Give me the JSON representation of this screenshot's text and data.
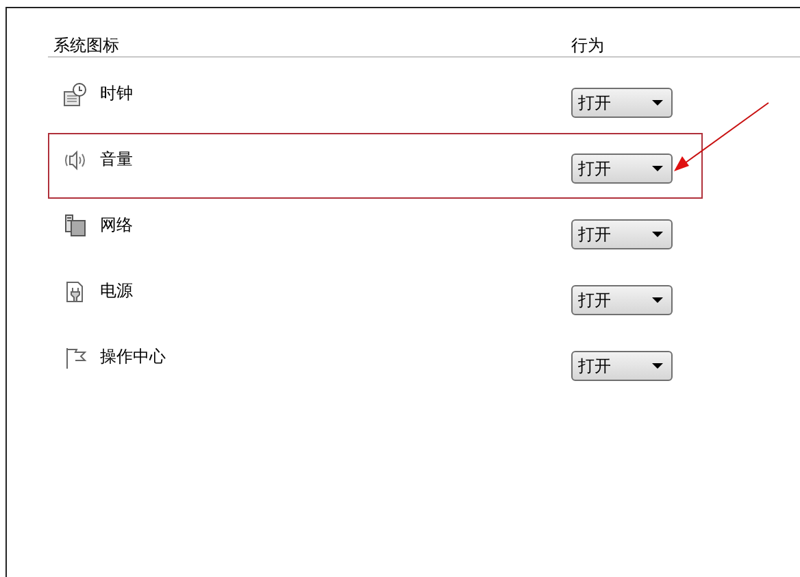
{
  "columns": [
    "系统图标",
    "行为"
  ],
  "rows": [
    {
      "kind": "clock",
      "name": "时钟",
      "behavior": "打开",
      "annotated": false
    },
    {
      "kind": "speaker",
      "name": "音量",
      "behavior": "打开",
      "annotated": true
    },
    {
      "kind": "network",
      "name": "网络",
      "behavior": "打开",
      "annotated": false
    },
    {
      "kind": "power",
      "name": "电源",
      "behavior": "打开",
      "annotated": false
    },
    {
      "kind": "flag",
      "name": "操作中心",
      "behavior": "打开",
      "annotated": false
    }
  ]
}
